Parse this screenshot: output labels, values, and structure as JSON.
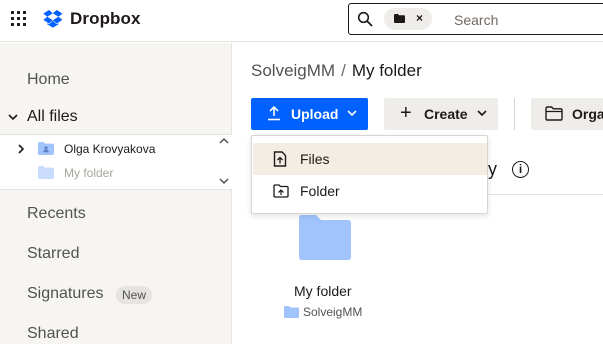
{
  "app": {
    "brand": "Dropbox"
  },
  "search": {
    "placeholder": "Search",
    "chip_icon": "folder-icon"
  },
  "sidebar": {
    "home": "Home",
    "all_files": "All files",
    "tree": [
      {
        "label": "Olga Krovyakova",
        "state": "collapsed"
      },
      {
        "label": "My folder",
        "state": "muted"
      }
    ],
    "recents": "Recents",
    "starred": "Starred",
    "signatures": "Signatures",
    "signatures_badge": "New",
    "shared": "Shared"
  },
  "breadcrumb": {
    "parent": "SolveigMM",
    "separator": "/",
    "current": "My folder"
  },
  "toolbar": {
    "upload_label": "Upload",
    "create_label": "Create",
    "organize_label": "Organize"
  },
  "upload_menu": [
    {
      "label": "Files",
      "icon": "file-upload-icon",
      "highlighted": true
    },
    {
      "label": "Folder",
      "icon": "folder-upload-icon",
      "highlighted": false
    }
  ],
  "activity": {
    "text_fragment": "ty"
  },
  "items": [
    {
      "name": "My folder",
      "location": "SolveigMM",
      "type": "folder"
    }
  ],
  "colors": {
    "accent": "#0061fe",
    "folder": "#a1c4fd",
    "sidebar_bg": "#f7f5f2",
    "menu_highlight": "#f4ede4"
  }
}
